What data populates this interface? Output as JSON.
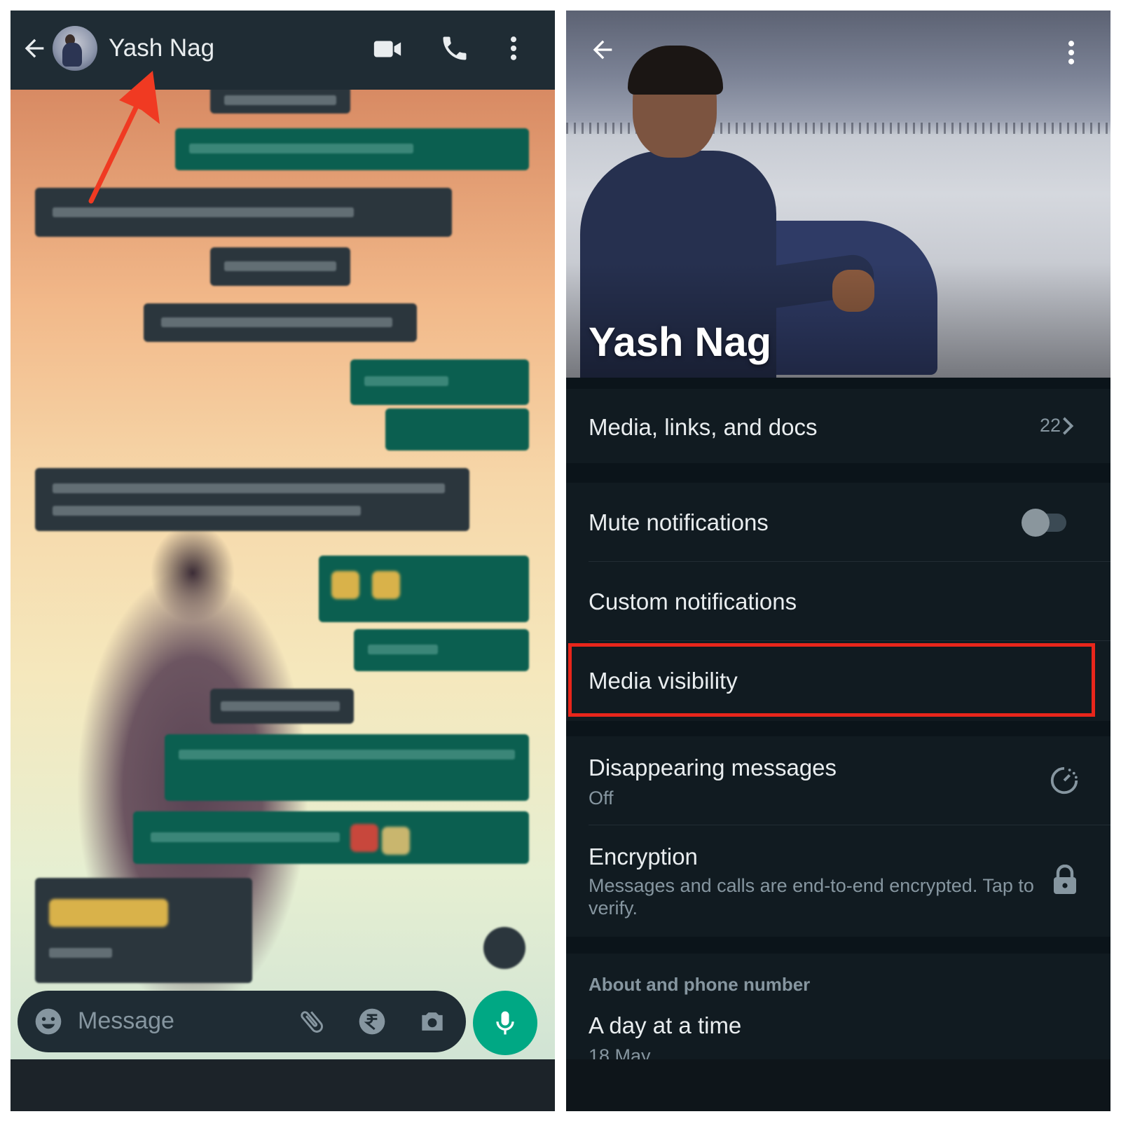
{
  "chat": {
    "contact_name": "Yash Nag",
    "input_placeholder": "Message",
    "icons": [
      "back-arrow-icon",
      "video-call-icon",
      "phone-icon",
      "more-vert-icon",
      "emoji-icon",
      "attach-icon",
      "rupee-icon",
      "camera-icon",
      "mic-icon"
    ]
  },
  "contact_info": {
    "name": "Yash Nag",
    "media_row": {
      "label": "Media, links, and docs",
      "count": "22"
    },
    "mute_row": {
      "label": "Mute notifications",
      "enabled": false
    },
    "custom_notifications_label": "Custom notifications",
    "media_visibility_label": "Media visibility",
    "disappearing": {
      "label": "Disappearing messages",
      "value": "Off"
    },
    "encryption": {
      "label": "Encryption",
      "description": "Messages and calls are end-to-end encrypted. Tap to verify."
    },
    "about": {
      "section_title": "About and phone number",
      "text": "A day at a time",
      "date": "18 May"
    }
  },
  "colors": {
    "accent_green": "#00a884",
    "annotation_red": "#e8261b",
    "panel_bg": "#111b21",
    "header_bg": "#1f2c34"
  }
}
